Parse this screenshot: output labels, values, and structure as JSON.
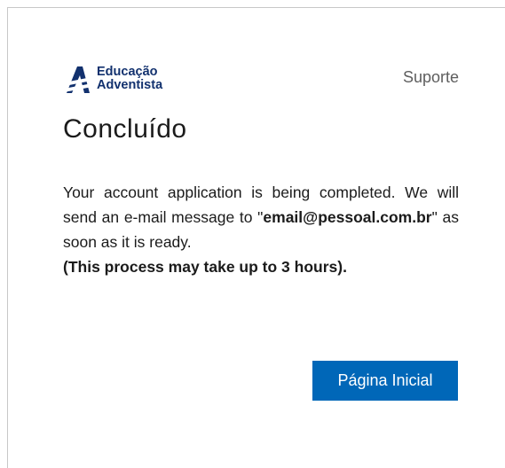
{
  "header": {
    "logo": {
      "line1": "Educação",
      "line2": "Adventista",
      "icon": "educacao-adventista-logo-icon"
    },
    "support_link": "Suporte"
  },
  "main": {
    "title": "Concluído",
    "message": {
      "text1": "Your account application is being completed. We will send an e-mail message to \"",
      "email": "email@pessoal.com.br",
      "text2": "\" as soon as it is ready.",
      "notice": "(This process may take up to 3 hours)."
    },
    "button_label": "Página Inicial"
  },
  "colors": {
    "primary": "#0067b8",
    "brand": "#12316e",
    "muted_text": "#5e5e5e",
    "text": "#1b1b1b"
  }
}
